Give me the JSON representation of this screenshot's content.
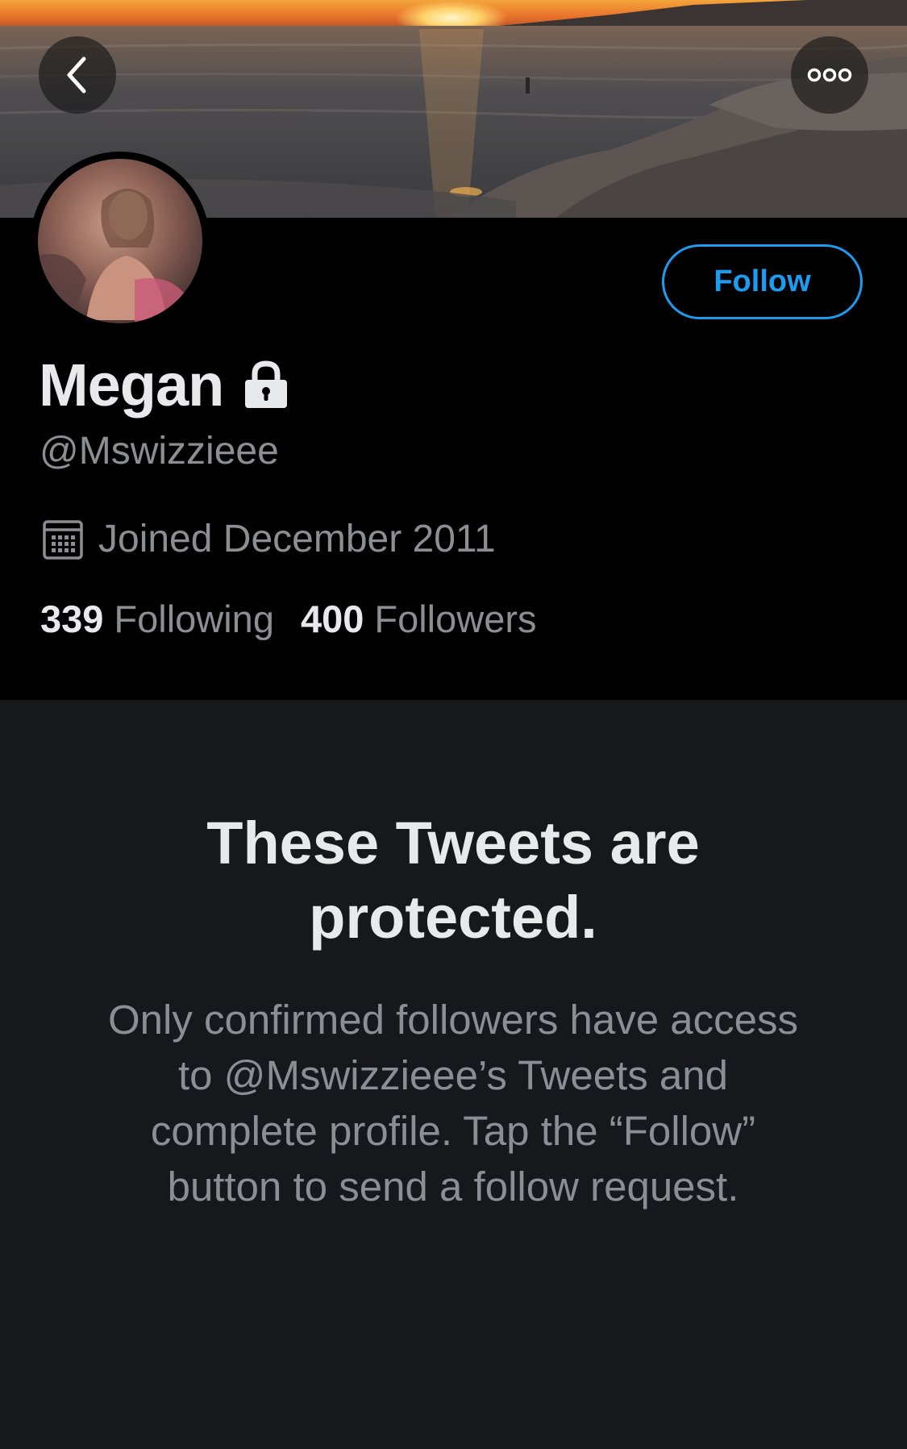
{
  "header": {
    "back_icon": "chevron-left-icon",
    "more_icon": "more-horizontal-icon",
    "banner_image": "sunset-beach-banner"
  },
  "profile": {
    "avatar": "profile-avatar",
    "display_name": "Megan",
    "lock_icon": "lock-icon",
    "handle": "@Mswizzieee",
    "follow_label": "Follow",
    "joined_icon": "calendar-icon",
    "joined_text": "Joined December 2011",
    "following_count": "339",
    "following_label": "Following",
    "followers_count": "400",
    "followers_label": "Followers"
  },
  "protected": {
    "title": "These Tweets are protected.",
    "body": "Only confirmed followers have access to @Mswizzieee’s Tweets and complete profile. Tap the “Follow” button to send a follow request."
  },
  "colors": {
    "accent": "#1d9bf0",
    "text_primary": "#e7e9ea",
    "text_secondary": "#8b8f94",
    "profile_bg": "#000000",
    "content_bg": "#16181c"
  }
}
